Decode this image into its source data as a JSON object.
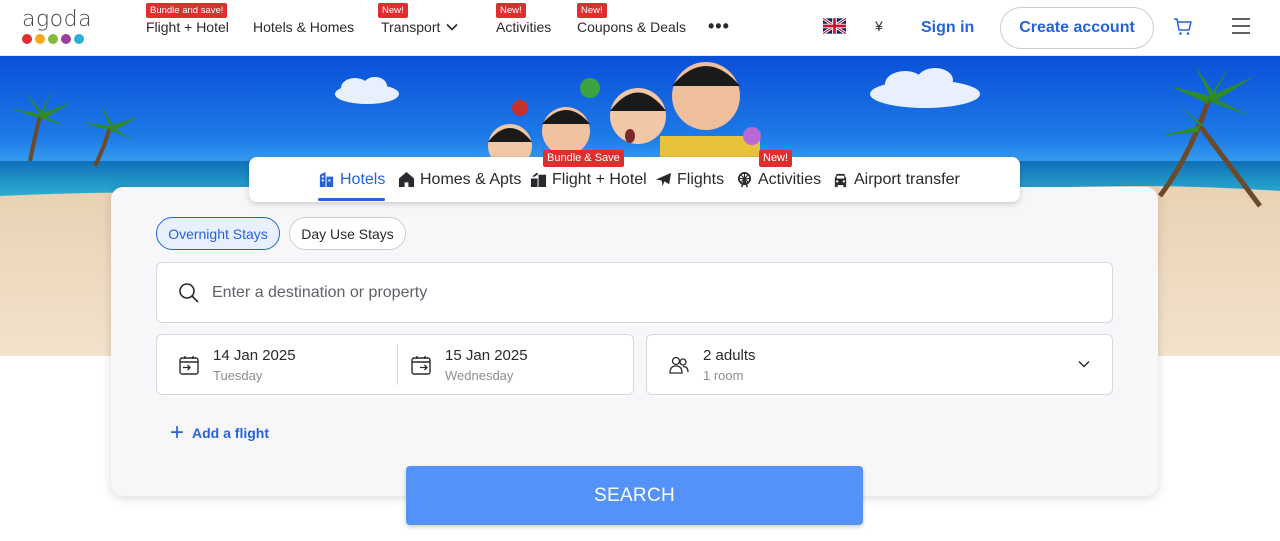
{
  "logo": {
    "text": "agoda",
    "dot_colors": [
      "#e12d2d",
      "#f9a619",
      "#7dbb42",
      "#9b3f9b",
      "#2bb1d8"
    ]
  },
  "nav": {
    "items": [
      {
        "label": "Flight + Hotel",
        "badge": "Bundle and save!"
      },
      {
        "label": "Hotels & Homes",
        "badge": ""
      },
      {
        "label": "Transport",
        "badge": "New!"
      },
      {
        "label": "Activities",
        "badge": "New!"
      },
      {
        "label": "Coupons & Deals",
        "badge": "New!"
      }
    ],
    "more": "•••",
    "currency": "¥",
    "sign_in": "Sign in",
    "create_account": "Create account"
  },
  "tabs": [
    {
      "label": "Hotels",
      "icon": "hotel-icon",
      "badge": ""
    },
    {
      "label": "Homes & Apts",
      "icon": "home-icon",
      "badge": ""
    },
    {
      "label": "Flight + Hotel",
      "icon": "flight-hotel-icon",
      "badge": "Bundle & Save"
    },
    {
      "label": "Flights",
      "icon": "plane-icon",
      "badge": ""
    },
    {
      "label": "Activities",
      "icon": "ferris-wheel-icon",
      "badge": "New!"
    },
    {
      "label": "Airport transfer",
      "icon": "car-icon",
      "badge": ""
    }
  ],
  "stay_types": {
    "overnight": "Overnight Stays",
    "day_use": "Day Use Stays"
  },
  "search": {
    "placeholder": "Enter a destination or property"
  },
  "check_in": {
    "date": "14 Jan 2025",
    "day": "Tuesday"
  },
  "check_out": {
    "date": "15 Jan 2025",
    "day": "Wednesday"
  },
  "guests": {
    "adults": "2 adults",
    "rooms": "1 room"
  },
  "add_flight": "Add a flight",
  "search_button": "SEARCH",
  "colors": {
    "brand_blue": "#2563d8",
    "search_button": "#5392f9",
    "badge_red": "#e12d2d"
  }
}
